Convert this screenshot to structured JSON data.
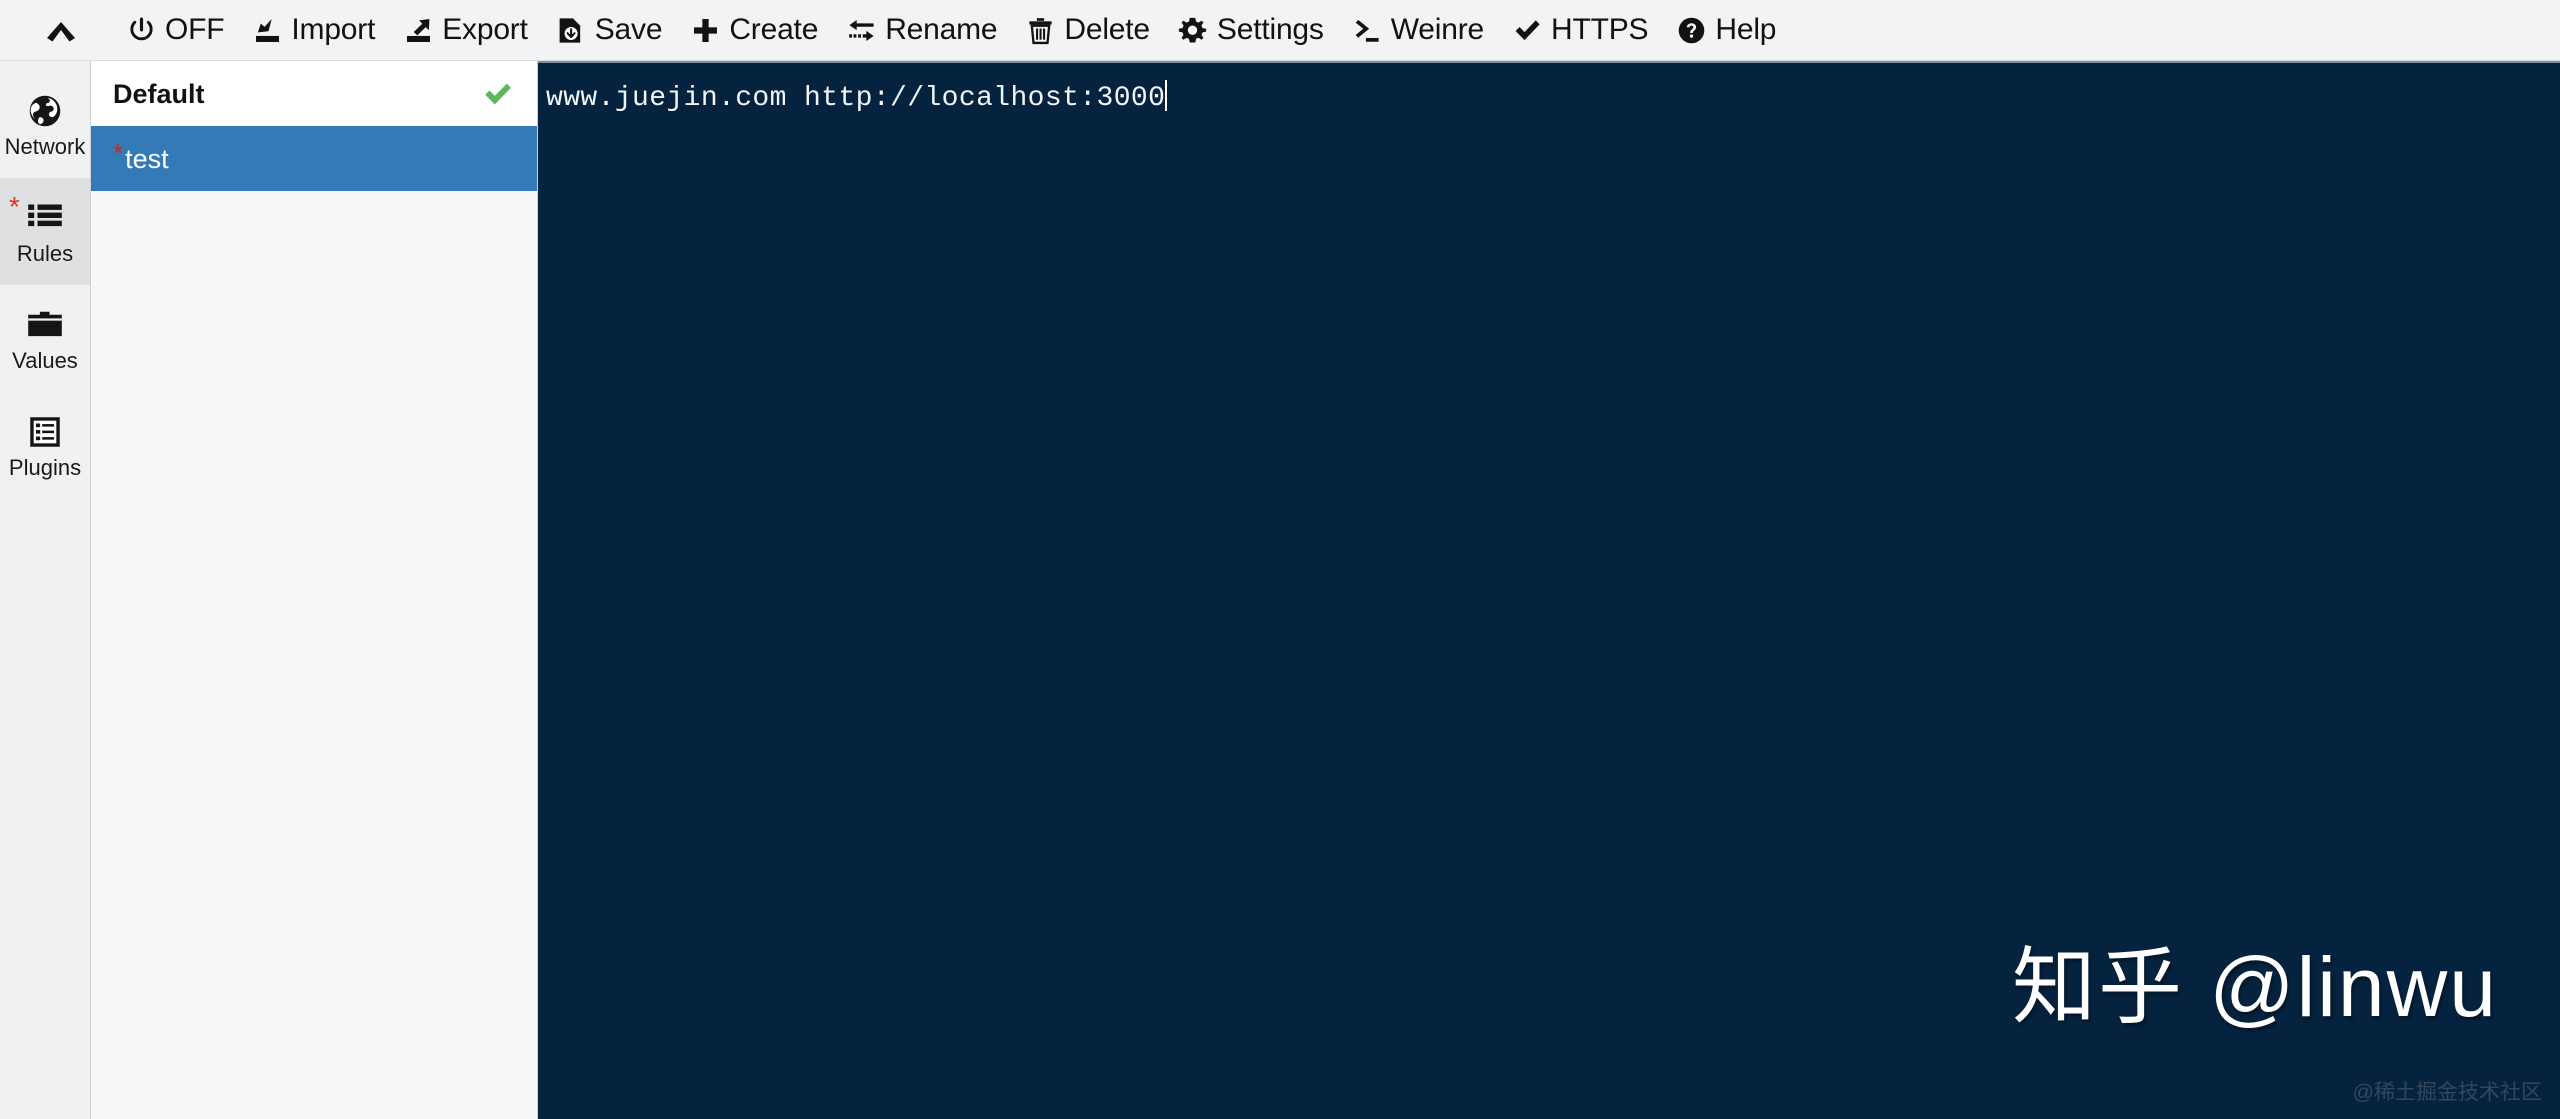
{
  "toolbar": {
    "collapse_icon": "chevron-up-icon",
    "items": [
      {
        "id": "power",
        "label": "OFF",
        "icon": "power-icon"
      },
      {
        "id": "import",
        "label": "Import",
        "icon": "import-icon"
      },
      {
        "id": "export",
        "label": "Export",
        "icon": "export-icon"
      },
      {
        "id": "save",
        "label": "Save",
        "icon": "save-icon"
      },
      {
        "id": "create",
        "label": "Create",
        "icon": "plus-icon"
      },
      {
        "id": "rename",
        "label": "Rename",
        "icon": "rename-arrows-icon"
      },
      {
        "id": "delete",
        "label": "Delete",
        "icon": "trash-icon"
      },
      {
        "id": "settings",
        "label": "Settings",
        "icon": "gear-icon"
      },
      {
        "id": "weinre",
        "label": "Weinre",
        "icon": "terminal-prompt-icon"
      },
      {
        "id": "https",
        "label": "HTTPS",
        "icon": "check-icon"
      },
      {
        "id": "help",
        "label": "Help",
        "icon": "question-circle-icon"
      }
    ]
  },
  "sidebar": {
    "items": [
      {
        "id": "network",
        "label": "Network",
        "icon": "globe-icon",
        "active": false,
        "modified": false
      },
      {
        "id": "rules",
        "label": "Rules",
        "icon": "list-icon",
        "active": true,
        "modified": true
      },
      {
        "id": "values",
        "label": "Values",
        "icon": "folder-icon",
        "active": false,
        "modified": false
      },
      {
        "id": "plugins",
        "label": "Plugins",
        "icon": "plugins-icon",
        "active": false,
        "modified": false
      }
    ]
  },
  "rules_list": {
    "rows": [
      {
        "name": "Default",
        "selected": false,
        "enabled": true,
        "modified": false
      },
      {
        "name": "test",
        "selected": true,
        "enabled": false,
        "modified": true
      }
    ]
  },
  "editor": {
    "lines": [
      "www.juejin.com http://localhost:3000"
    ],
    "cursor_visible": true,
    "background_color": "#05233f",
    "text_color": "#f2f4f6"
  },
  "watermark": {
    "main": "知乎 @linwu",
    "sub": "@稀土掘金技术社区"
  },
  "colors": {
    "selection_blue": "#347ab7",
    "check_green": "#5cb85c",
    "modified_red": "#e2322b",
    "toolbar_bg": "#f2f3f4",
    "rail_bg": "#f0f1f2"
  }
}
